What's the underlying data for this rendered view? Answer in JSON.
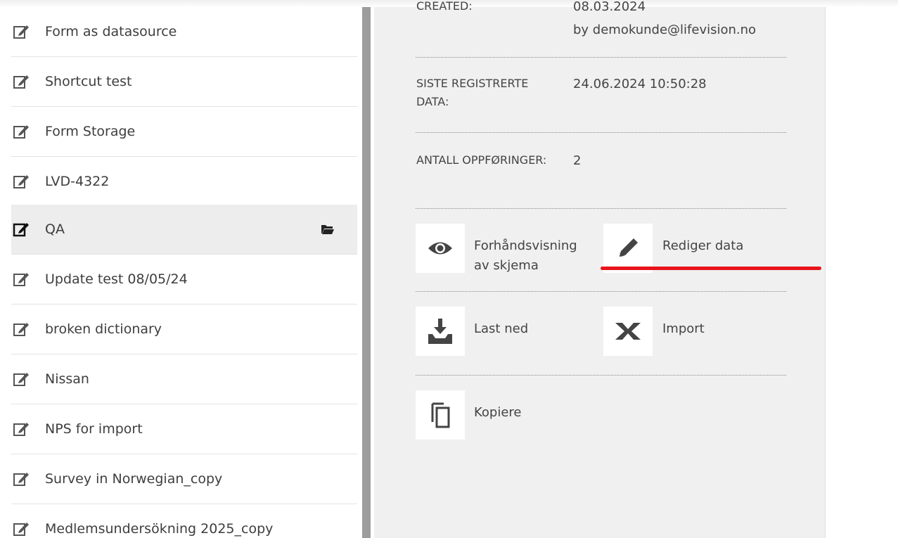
{
  "list": {
    "items": [
      {
        "label": "Form as datasource",
        "selected": false
      },
      {
        "label": "Shortcut test",
        "selected": false
      },
      {
        "label": "Form Storage",
        "selected": false
      },
      {
        "label": "LVD-4322",
        "selected": false
      },
      {
        "label": "QA",
        "selected": true
      },
      {
        "label": "Update test 08/05/24",
        "selected": false
      },
      {
        "label": "broken dictionary",
        "selected": false
      },
      {
        "label": "Nissan",
        "selected": false
      },
      {
        "label": "NPS for import",
        "selected": false
      },
      {
        "label": "Survey in Norwegian_copy",
        "selected": false
      },
      {
        "label": "Medlemsundersökning 2025_copy",
        "selected": false
      }
    ],
    "item_icon": "edit-icon",
    "selected_action_icon": "folder-open-icon"
  },
  "details": {
    "created": {
      "label": "CREATED:",
      "date": "08.03.2024",
      "by": "by demokunde@lifevision.no"
    },
    "last_data": {
      "label": "SISTE REGISTRERTE DATA:",
      "value": "24.06.2024 10:50:28"
    },
    "count": {
      "label": "ANTALL OPPFØRINGER:",
      "value": "2"
    }
  },
  "actions": {
    "preview": {
      "label_line1": "Forhåndsvisning",
      "label_line2": "av skjema",
      "icon": "eye-icon"
    },
    "edit_data": {
      "label": "Rediger data",
      "icon": "pencil-icon"
    },
    "download": {
      "label": "Last ned",
      "icon": "download-icon"
    },
    "import": {
      "label": "Import",
      "icon": "excel-icon"
    },
    "copy": {
      "label": "Kopiere",
      "icon": "copy-icon"
    }
  },
  "colors": {
    "highlight_underline": "#e8141b",
    "panel_bg": "#f0f0f0",
    "selected_row_bg": "#ededed"
  }
}
